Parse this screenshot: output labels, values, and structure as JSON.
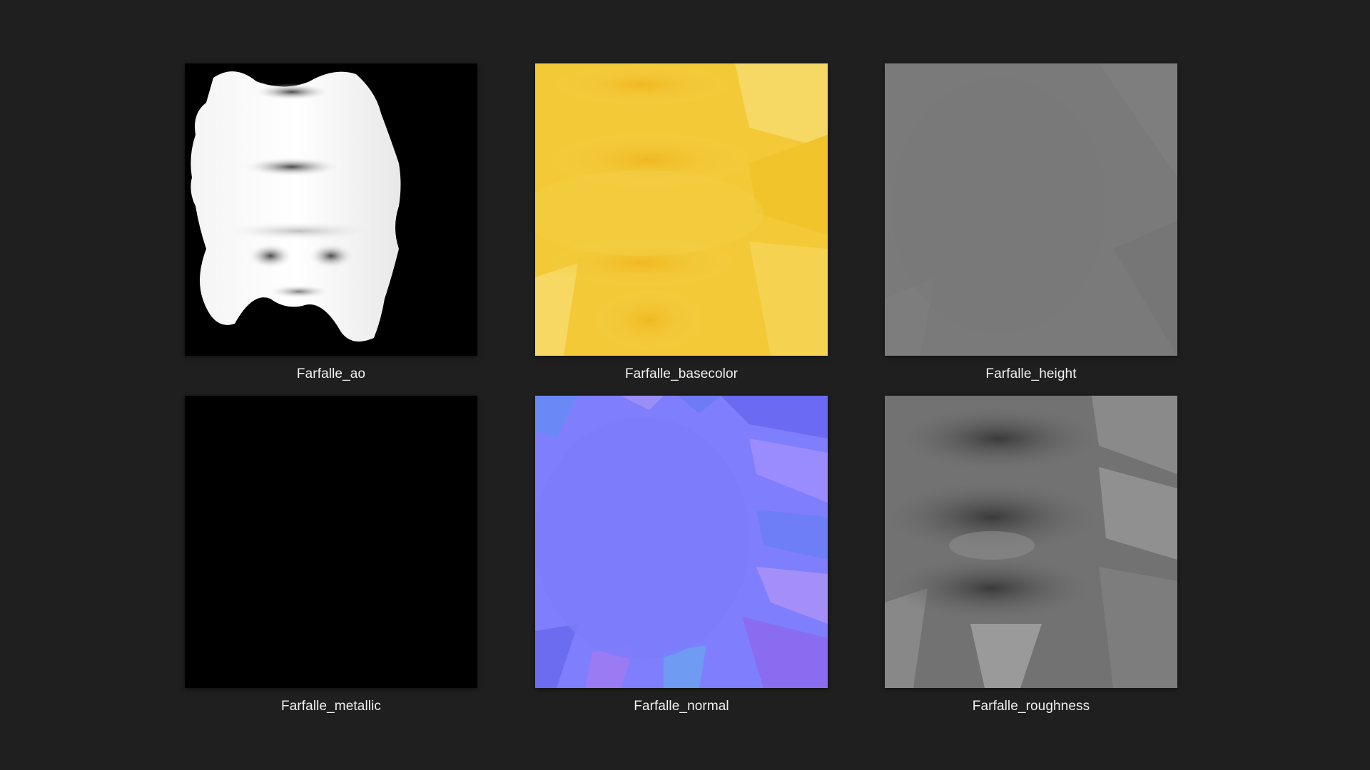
{
  "files": [
    {
      "key": "ao",
      "label": "Farfalle_ao",
      "icon": "ao-texture-thumbnail"
    },
    {
      "key": "basecolor",
      "label": "Farfalle_basecolor",
      "icon": "basecolor-texture-thumbnail"
    },
    {
      "key": "height",
      "label": "Farfalle_height",
      "icon": "height-texture-thumbnail"
    },
    {
      "key": "metallic",
      "label": "Farfalle_metallic",
      "icon": "metallic-texture-thumbnail"
    },
    {
      "key": "normal",
      "label": "Farfalle_normal",
      "icon": "normal-texture-thumbnail"
    },
    {
      "key": "roughness",
      "label": "Farfalle_roughness",
      "icon": "roughness-texture-thumbnail"
    }
  ],
  "colors": {
    "background": "#1f1f1f",
    "caption": "#f0f0f0",
    "basecolor": "#f2c52f",
    "height": "#7a7a7a",
    "metallic": "#000000",
    "normal": "#7f7ffd",
    "roughness": "#6a6a6a"
  }
}
